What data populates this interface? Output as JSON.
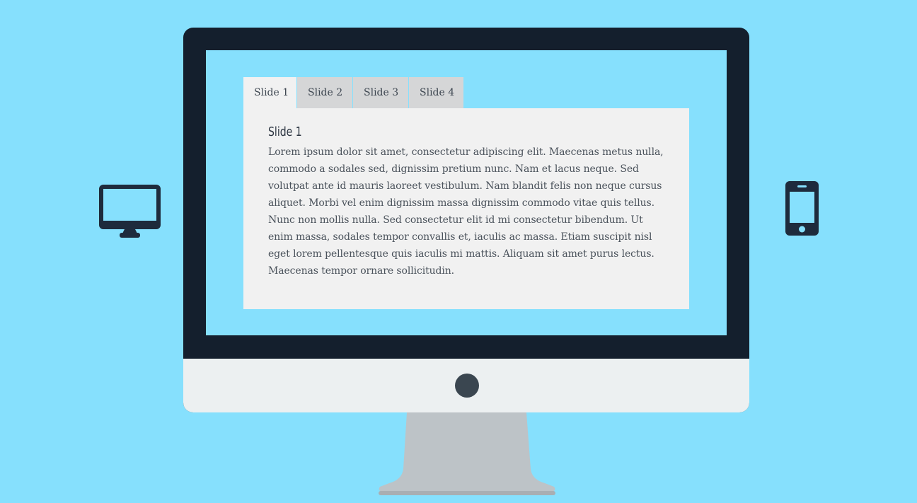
{
  "colors": {
    "background": "#86e0fd",
    "monitor_frame": "#141f2d",
    "monitor_chin": "#ecf0f1",
    "power_button": "#3a4650",
    "stand": "#bdc3c7",
    "tab_inactive": "#d5d6d7",
    "tab_active": "#f1f1f1",
    "icon": "#1e2b3c"
  },
  "icons": {
    "left": "desktop-monitor-icon",
    "right": "smartphone-icon"
  },
  "tabs": [
    {
      "label": "Slide 1",
      "active": true
    },
    {
      "label": "Slide 2",
      "active": false
    },
    {
      "label": "Slide 3",
      "active": false
    },
    {
      "label": "Slide 4",
      "active": false
    }
  ],
  "panel": {
    "title": "Slide 1",
    "body": "Lorem ipsum dolor sit amet, consectetur adipiscing elit. Maecenas metus nulla, commodo a sodales sed, dignissim pretium nunc. Nam et lacus neque. Sed volutpat ante id mauris laoreet vestibulum. Nam blandit felis non neque cursus aliquet. Morbi vel enim dignissim massa dignissim commodo vitae quis tellus. Nunc non mollis nulla. Sed consectetur elit id mi consectetur bibendum. Ut enim massa, sodales tempor convallis et, iaculis ac massa. Etiam suscipit nisl eget lorem pellentesque quis iaculis mi mattis. Aliquam sit amet purus lectus. Maecenas tempor ornare sollicitudin."
  }
}
